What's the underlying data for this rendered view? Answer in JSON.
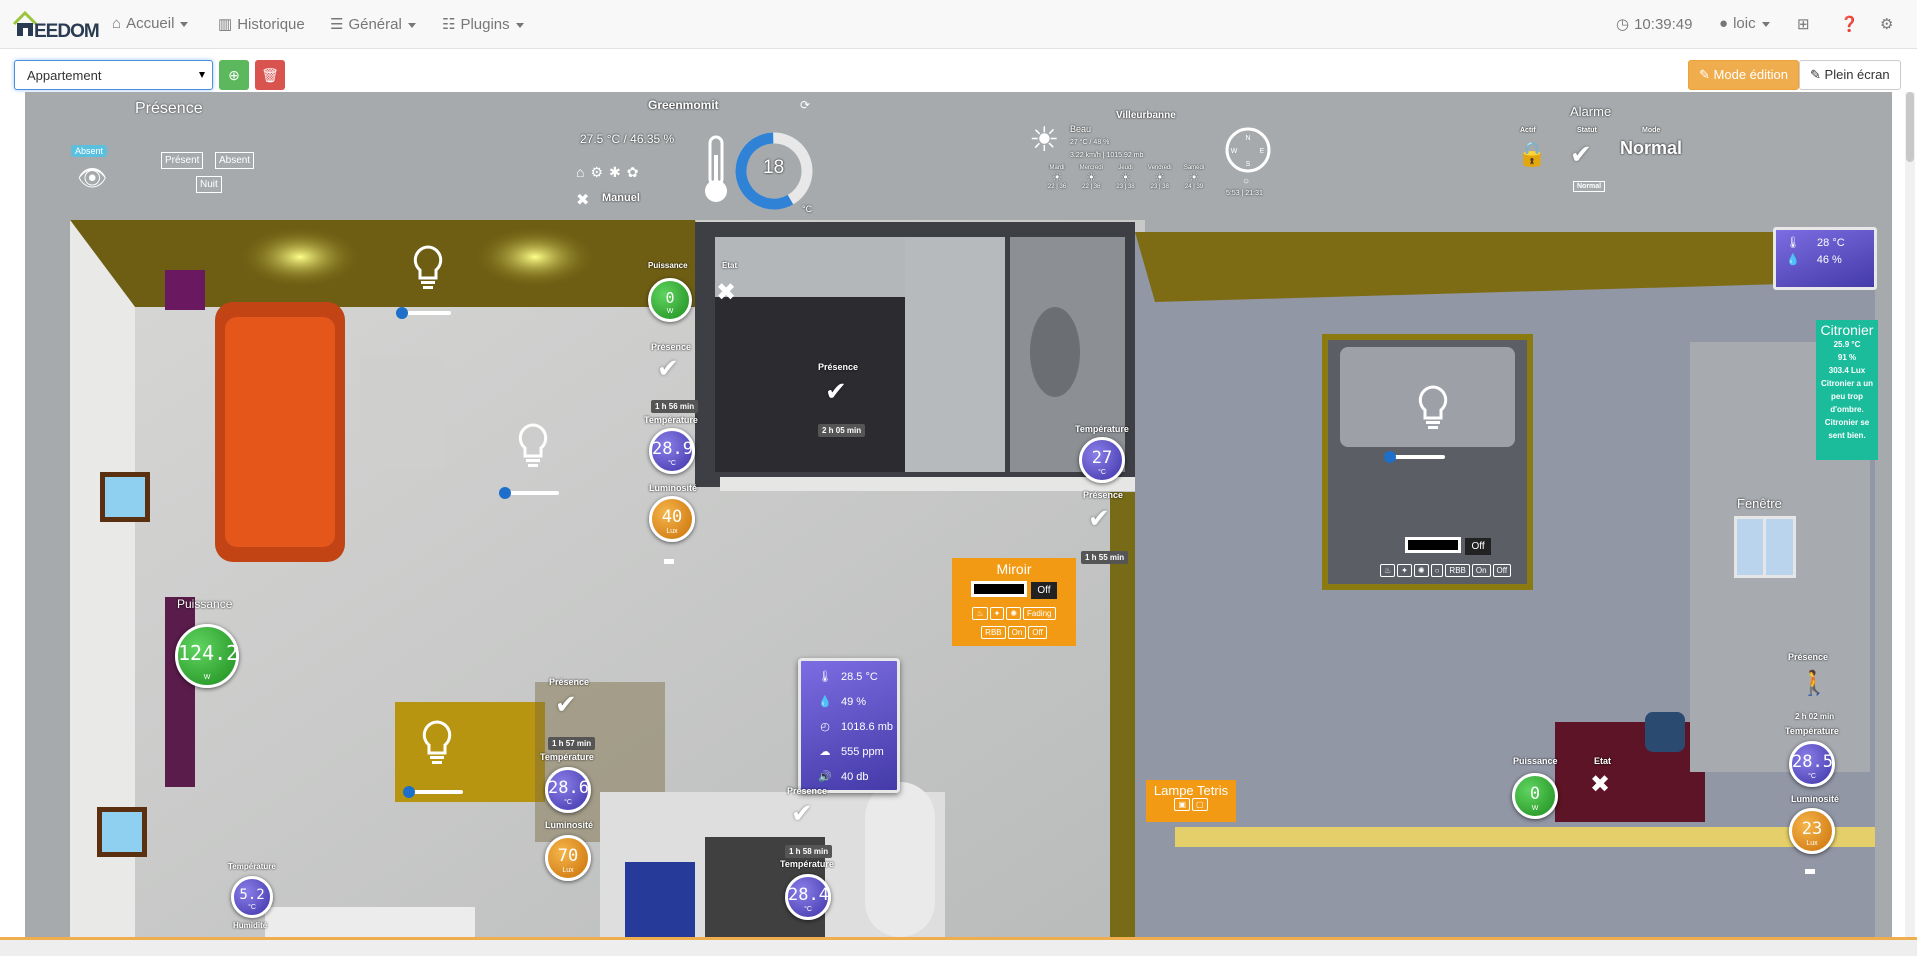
{
  "navbar": {
    "brand": "EEDOM",
    "items": [
      {
        "icon": "home-icon",
        "label": "Accueil"
      },
      {
        "icon": "bar-chart-icon",
        "label": "Historique"
      },
      {
        "icon": "list-icon",
        "label": "Général"
      },
      {
        "icon": "tasks-icon",
        "label": "Plugins"
      }
    ],
    "clock": "10:39:49",
    "user": "loic"
  },
  "toolbar": {
    "plan_select": "Appartement",
    "edit_label": "Mode édition",
    "fullscreen_label": "Plein écran"
  },
  "presence_mode": {
    "title": "Présence",
    "badge": "Absent",
    "buttons": [
      "Présent",
      "Absent",
      "Nuit"
    ]
  },
  "thermostat": {
    "name": "Greenmomit",
    "reading": "27.5 °C / 46.35 %",
    "setpoint": "18",
    "unit": "°C",
    "mode": "Manuel"
  },
  "weather": {
    "city": "Villeurbanne",
    "condition": "Beau",
    "line1": "27 °C / 48 %",
    "line2": "3.22 km/h | 1015.92 mb",
    "days": [
      {
        "name": "Mardi",
        "temps": "22 | 36"
      },
      {
        "name": "Mercredi",
        "temps": "22 | 36"
      },
      {
        "name": "Jeudi",
        "temps": "23 | 38"
      },
      {
        "name": "Vendredi",
        "temps": "23 | 38"
      },
      {
        "name": "Samedi",
        "temps": "24 | 39"
      }
    ],
    "sun": "5:53 | 21:31"
  },
  "alarm": {
    "title": "Alarme",
    "actif_label": "Actif",
    "statut_label": "Statut",
    "mode_label": "Mode",
    "mode_value": "Normal",
    "statut_value": "Normal"
  },
  "living": {
    "puissance_small_label": "Puissance",
    "puissance_small_value": "0",
    "puissance_small_unit": "W",
    "etat_label": "Etat",
    "presence_label": "Présence",
    "presence_duration": "1 h 56 min",
    "temp_label": "Température",
    "temp_value": "28.9",
    "temp_unit": "°C",
    "lum_label": "Luminosité",
    "lum_value": "40",
    "lum_unit": "Lux",
    "puissance_label": "Puissance",
    "puissance_value": "124.2",
    "puissance_unit": "W"
  },
  "bathroom": {
    "presence_label": "Présence",
    "presence_duration": "2 h 05 min",
    "temp_label": "Température",
    "temp_value": "27",
    "temp_unit": "°C",
    "presence2_label": "Présence",
    "presence2_duration": "1 h 55 min"
  },
  "miroir": {
    "title": "Miroir",
    "state": "Off",
    "buttons": [
      "Fading",
      "RBB",
      "On",
      "Off"
    ]
  },
  "env_sensor": {
    "rows": [
      {
        "icon": "thermometer-icon",
        "value": "28.5 °C"
      },
      {
        "icon": "humidity-icon",
        "value": "49 %"
      },
      {
        "icon": "pressure-icon",
        "value": "1018.6 mb"
      },
      {
        "icon": "co2-icon",
        "value": "555 ppm"
      },
      {
        "icon": "sound-icon",
        "value": "40 db"
      }
    ]
  },
  "dining": {
    "presence_label": "Présence",
    "presence_duration": "1 h 57 min",
    "temp_label": "Température",
    "temp_value": "28.6",
    "temp_unit": "°C",
    "lum_label": "Luminosité",
    "lum_value": "70",
    "lum_unit": "Lux"
  },
  "kitchen": {
    "presence_label": "Présence",
    "presence_duration": "1 h 58 min",
    "temp_label": "Température",
    "temp_value": "28.4",
    "temp_unit": "°C"
  },
  "entry": {
    "temp_label": "Température",
    "temp_value": "5.2",
    "temp_unit": "°C",
    "hum_label": "Humidité"
  },
  "bedroom": {
    "mini_temp": "28 °C",
    "mini_hum": "46 %",
    "citronier_title": "Citronier",
    "citronier_lines": [
      "25.9 °C",
      "91 %",
      "303.4 Lux",
      "Citronier a un peu trop d'ombre.",
      "Citronier se sent bien."
    ],
    "fenetre_label": "Fenêtre",
    "light_state": "Off",
    "light_buttons": [
      "RBB",
      "On",
      "Off"
    ],
    "lampe_label": "Lampe Tetris",
    "puissance_label": "Puissance",
    "puissance_value": "0",
    "puissance_unit": "W",
    "etat_label": "Etat",
    "presence_label": "Présence",
    "presence_duration": "2 h 02 min",
    "temp_label": "Température",
    "temp_value": "28.5",
    "temp_unit": "°C",
    "lum_label": "Luminosité",
    "lum_value": "23",
    "lum_unit": "Lux"
  },
  "colors": {
    "accent_orange": "#f0ad4e",
    "success_green": "#5cb85c",
    "danger_red": "#d9534f",
    "teal_panel": "#1abc9c",
    "gauge_purple": "#4c3fbf"
  }
}
